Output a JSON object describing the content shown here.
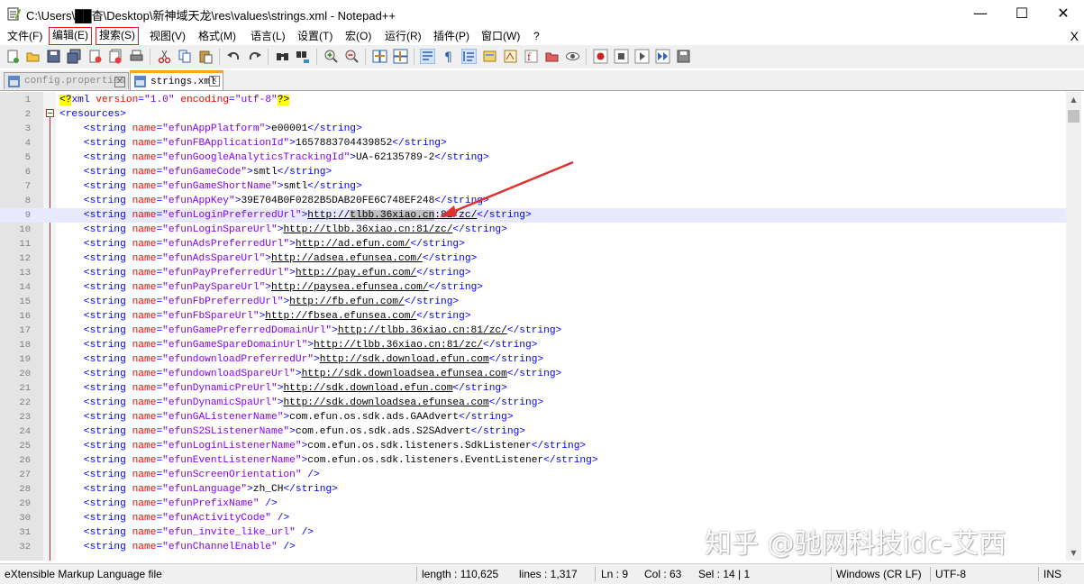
{
  "window": {
    "title": "C:\\Users\\██杳\\Desktop\\新神域天龙\\res\\values\\strings.xml - Notepad++",
    "minimize": "—",
    "maximize": "☐",
    "close": "✕"
  },
  "menu": {
    "items": [
      "文件(F)",
      "编辑(E)",
      "搜索(S)",
      "视图(V)",
      "格式(M)",
      "语言(L)",
      "设置(T)",
      "宏(O)",
      "运行(R)",
      "插件(P)",
      "窗口(W)",
      "?"
    ],
    "highlighted": [
      "编辑(E)",
      "搜索(S)"
    ],
    "close_doc": "X"
  },
  "tabs": [
    {
      "label": "config.properties",
      "active": false,
      "close": "x"
    },
    {
      "label": "strings.xml",
      "active": true,
      "close": "x"
    }
  ],
  "editor": {
    "current_line": 9,
    "lines": [
      {
        "n": "1",
        "p": [
          [
            "decl",
            "<?"
          ],
          [
            "tag",
            "xml "
          ],
          [
            "attr",
            "version"
          ],
          [
            "tag",
            "="
          ],
          [
            "val",
            "\"1.0\""
          ],
          [
            "tag",
            " "
          ],
          [
            "attr",
            "encoding"
          ],
          [
            "tag",
            "="
          ],
          [
            "val",
            "\"utf-8\""
          ],
          [
            "decl",
            "?>"
          ]
        ]
      },
      {
        "n": "2",
        "p": [
          [
            "tag",
            "<resources>"
          ]
        ]
      },
      {
        "n": "3",
        "p": [
          [
            "tag",
            "    <string "
          ],
          [
            "attr",
            "name"
          ],
          [
            "tag",
            "="
          ],
          [
            "val",
            "\"efunAppPlatform\""
          ],
          [
            "tag",
            ">"
          ],
          [
            "text",
            "e00001"
          ],
          [
            "tag",
            "</string>"
          ]
        ]
      },
      {
        "n": "4",
        "p": [
          [
            "tag",
            "    <string "
          ],
          [
            "attr",
            "name"
          ],
          [
            "tag",
            "="
          ],
          [
            "val",
            "\"efunFBApplicationId\""
          ],
          [
            "tag",
            ">"
          ],
          [
            "text",
            "1657883704439852"
          ],
          [
            "tag",
            "</string>"
          ]
        ]
      },
      {
        "n": "5",
        "p": [
          [
            "tag",
            "    <string "
          ],
          [
            "attr",
            "name"
          ],
          [
            "tag",
            "="
          ],
          [
            "val",
            "\"efunGoogleAnalyticsTrackingId\""
          ],
          [
            "tag",
            ">"
          ],
          [
            "text",
            "UA-62135789-2"
          ],
          [
            "tag",
            "</string>"
          ]
        ]
      },
      {
        "n": "6",
        "p": [
          [
            "tag",
            "    <string "
          ],
          [
            "attr",
            "name"
          ],
          [
            "tag",
            "="
          ],
          [
            "val",
            "\"efunGameCode\""
          ],
          [
            "tag",
            ">"
          ],
          [
            "text",
            "smtl"
          ],
          [
            "tag",
            "</string>"
          ]
        ]
      },
      {
        "n": "7",
        "p": [
          [
            "tag",
            "    <string "
          ],
          [
            "attr",
            "name"
          ],
          [
            "tag",
            "="
          ],
          [
            "val",
            "\"efunGameShortName\""
          ],
          [
            "tag",
            ">"
          ],
          [
            "text",
            "smtl"
          ],
          [
            "tag",
            "</string>"
          ]
        ]
      },
      {
        "n": "8",
        "p": [
          [
            "tag",
            "    <string "
          ],
          [
            "attr",
            "name"
          ],
          [
            "tag",
            "="
          ],
          [
            "val",
            "\"efunAppKey\""
          ],
          [
            "tag",
            ">"
          ],
          [
            "text",
            "39E704B0F0282B5DAB20FE6C748EF248"
          ],
          [
            "tag",
            "</string>"
          ]
        ]
      },
      {
        "n": "9",
        "p": [
          [
            "tag",
            "    <string "
          ],
          [
            "attr",
            "name"
          ],
          [
            "tag",
            "="
          ],
          [
            "val",
            "\"efunLoginPreferredUrl\""
          ],
          [
            "tag",
            ">"
          ],
          [
            "url",
            "http://"
          ],
          [
            "sel",
            "tlbb.36xiao.cn"
          ],
          [
            "url",
            ":81/zc/"
          ],
          [
            "tag",
            "</string>"
          ]
        ]
      },
      {
        "n": "10",
        "p": [
          [
            "tag",
            "    <string "
          ],
          [
            "attr",
            "name"
          ],
          [
            "tag",
            "="
          ],
          [
            "val",
            "\"efunLoginSpareUrl\""
          ],
          [
            "tag",
            ">"
          ],
          [
            "url",
            "http://tlbb.36xiao.cn:81/zc/"
          ],
          [
            "tag",
            "</string>"
          ]
        ]
      },
      {
        "n": "11",
        "p": [
          [
            "tag",
            "    <string "
          ],
          [
            "attr",
            "name"
          ],
          [
            "tag",
            "="
          ],
          [
            "val",
            "\"efunAdsPreferredUrl\""
          ],
          [
            "tag",
            ">"
          ],
          [
            "url",
            "http://ad.efun.com/"
          ],
          [
            "tag",
            "</string>"
          ]
        ]
      },
      {
        "n": "12",
        "p": [
          [
            "tag",
            "    <string "
          ],
          [
            "attr",
            "name"
          ],
          [
            "tag",
            "="
          ],
          [
            "val",
            "\"efunAdsSpareUrl\""
          ],
          [
            "tag",
            ">"
          ],
          [
            "url",
            "http://adsea.efunsea.com/"
          ],
          [
            "tag",
            "</string>"
          ]
        ]
      },
      {
        "n": "13",
        "p": [
          [
            "tag",
            "    <string "
          ],
          [
            "attr",
            "name"
          ],
          [
            "tag",
            "="
          ],
          [
            "val",
            "\"efunPayPreferredUrl\""
          ],
          [
            "tag",
            ">"
          ],
          [
            "url",
            "http://pay.efun.com/"
          ],
          [
            "tag",
            "</string>"
          ]
        ]
      },
      {
        "n": "14",
        "p": [
          [
            "tag",
            "    <string "
          ],
          [
            "attr",
            "name"
          ],
          [
            "tag",
            "="
          ],
          [
            "val",
            "\"efunPaySpareUrl\""
          ],
          [
            "tag",
            ">"
          ],
          [
            "url",
            "http://paysea.efunsea.com/"
          ],
          [
            "tag",
            "</string>"
          ]
        ]
      },
      {
        "n": "15",
        "p": [
          [
            "tag",
            "    <string "
          ],
          [
            "attr",
            "name"
          ],
          [
            "tag",
            "="
          ],
          [
            "val",
            "\"efunFbPreferredUrl\""
          ],
          [
            "tag",
            ">"
          ],
          [
            "url",
            "http://fb.efun.com/"
          ],
          [
            "tag",
            "</string>"
          ]
        ]
      },
      {
        "n": "16",
        "p": [
          [
            "tag",
            "    <string "
          ],
          [
            "attr",
            "name"
          ],
          [
            "tag",
            "="
          ],
          [
            "val",
            "\"efunFbSpareUrl\""
          ],
          [
            "tag",
            ">"
          ],
          [
            "url",
            "http://fbsea.efunsea.com/"
          ],
          [
            "tag",
            "</string>"
          ]
        ]
      },
      {
        "n": "17",
        "p": [
          [
            "tag",
            "    <string "
          ],
          [
            "attr",
            "name"
          ],
          [
            "tag",
            "="
          ],
          [
            "val",
            "\"efunGamePreferredDomainUrl\""
          ],
          [
            "tag",
            ">"
          ],
          [
            "url",
            "http://tlbb.36xiao.cn:81/zc/"
          ],
          [
            "tag",
            "</string>"
          ]
        ]
      },
      {
        "n": "18",
        "p": [
          [
            "tag",
            "    <string "
          ],
          [
            "attr",
            "name"
          ],
          [
            "tag",
            "="
          ],
          [
            "val",
            "\"efunGameSpareDomainUrl\""
          ],
          [
            "tag",
            ">"
          ],
          [
            "url",
            "http://tlbb.36xiao.cn:81/zc/"
          ],
          [
            "tag",
            "</string>"
          ]
        ]
      },
      {
        "n": "19",
        "p": [
          [
            "tag",
            "    <string "
          ],
          [
            "attr",
            "name"
          ],
          [
            "tag",
            "="
          ],
          [
            "val",
            "\"efundownloadPreferredUr\""
          ],
          [
            "tag",
            ">"
          ],
          [
            "url",
            "http://sdk.download.efun.com"
          ],
          [
            "tag",
            "</string>"
          ]
        ]
      },
      {
        "n": "20",
        "p": [
          [
            "tag",
            "    <string "
          ],
          [
            "attr",
            "name"
          ],
          [
            "tag",
            "="
          ],
          [
            "val",
            "\"efundownloadSpareUrl\""
          ],
          [
            "tag",
            ">"
          ],
          [
            "url",
            "http://sdk.downloadsea.efunsea.com"
          ],
          [
            "tag",
            "</string>"
          ]
        ]
      },
      {
        "n": "21",
        "p": [
          [
            "tag",
            "    <string "
          ],
          [
            "attr",
            "name"
          ],
          [
            "tag",
            "="
          ],
          [
            "val",
            "\"efunDynamicPreUrl\""
          ],
          [
            "tag",
            ">"
          ],
          [
            "url",
            "http://sdk.download.efun.com"
          ],
          [
            "tag",
            "</string>"
          ]
        ]
      },
      {
        "n": "22",
        "p": [
          [
            "tag",
            "    <string "
          ],
          [
            "attr",
            "name"
          ],
          [
            "tag",
            "="
          ],
          [
            "val",
            "\"efunDynamicSpaUrl\""
          ],
          [
            "tag",
            ">"
          ],
          [
            "url",
            "http://sdk.downloadsea.efunsea.com"
          ],
          [
            "tag",
            "</string>"
          ]
        ]
      },
      {
        "n": "23",
        "p": [
          [
            "tag",
            "    <string "
          ],
          [
            "attr",
            "name"
          ],
          [
            "tag",
            "="
          ],
          [
            "val",
            "\"efunGAListenerName\""
          ],
          [
            "tag",
            ">"
          ],
          [
            "text",
            "com.efun.os.sdk.ads.GAAdvert"
          ],
          [
            "tag",
            "</string>"
          ]
        ]
      },
      {
        "n": "24",
        "p": [
          [
            "tag",
            "    <string "
          ],
          [
            "attr",
            "name"
          ],
          [
            "tag",
            "="
          ],
          [
            "val",
            "\"efunS2SListenerName\""
          ],
          [
            "tag",
            ">"
          ],
          [
            "text",
            "com.efun.os.sdk.ads.S2SAdvert"
          ],
          [
            "tag",
            "</string>"
          ]
        ]
      },
      {
        "n": "25",
        "p": [
          [
            "tag",
            "    <string "
          ],
          [
            "attr",
            "name"
          ],
          [
            "tag",
            "="
          ],
          [
            "val",
            "\"efunLoginListenerName\""
          ],
          [
            "tag",
            ">"
          ],
          [
            "text",
            "com.efun.os.sdk.listeners.SdkListener"
          ],
          [
            "tag",
            "</string>"
          ]
        ]
      },
      {
        "n": "26",
        "p": [
          [
            "tag",
            "    <string "
          ],
          [
            "attr",
            "name"
          ],
          [
            "tag",
            "="
          ],
          [
            "val",
            "\"efunEventListenerName\""
          ],
          [
            "tag",
            ">"
          ],
          [
            "text",
            "com.efun.os.sdk.listeners.EventListener"
          ],
          [
            "tag",
            "</string>"
          ]
        ]
      },
      {
        "n": "27",
        "p": [
          [
            "tag",
            "    <string "
          ],
          [
            "attr",
            "name"
          ],
          [
            "tag",
            "="
          ],
          [
            "val",
            "\"efunScreenOrientation\""
          ],
          [
            "tag",
            " />"
          ]
        ]
      },
      {
        "n": "28",
        "p": [
          [
            "tag",
            "    <string "
          ],
          [
            "attr",
            "name"
          ],
          [
            "tag",
            "="
          ],
          [
            "val",
            "\"efunLanguage\""
          ],
          [
            "tag",
            ">"
          ],
          [
            "text",
            "zh_CH"
          ],
          [
            "tag",
            "</string>"
          ]
        ]
      },
      {
        "n": "29",
        "p": [
          [
            "tag",
            "    <string "
          ],
          [
            "attr",
            "name"
          ],
          [
            "tag",
            "="
          ],
          [
            "val",
            "\"efunPrefixName\""
          ],
          [
            "tag",
            " />"
          ]
        ]
      },
      {
        "n": "30",
        "p": [
          [
            "tag",
            "    <string "
          ],
          [
            "attr",
            "name"
          ],
          [
            "tag",
            "="
          ],
          [
            "val",
            "\"efunActivityCode\""
          ],
          [
            "tag",
            " />"
          ]
        ]
      },
      {
        "n": "31",
        "p": [
          [
            "tag",
            "    <string "
          ],
          [
            "attr",
            "name"
          ],
          [
            "tag",
            "="
          ],
          [
            "val",
            "\"efun_invite_like_url\""
          ],
          [
            "tag",
            " />"
          ]
        ]
      },
      {
        "n": "32",
        "p": [
          [
            "tag",
            "    <string "
          ],
          [
            "attr",
            "name"
          ],
          [
            "tag",
            "="
          ],
          [
            "val",
            "\"efunChannelEnable\""
          ],
          [
            "tag",
            " />"
          ]
        ]
      }
    ]
  },
  "status": {
    "file_type": "eXtensible Markup Language file",
    "length": "length : 110,625",
    "lines": "lines : 1,317",
    "ln": "Ln : 9",
    "col": "Col : 63",
    "sel": "Sel : 14 | 1",
    "eol": "Windows (CR LF)",
    "encoding": "UTF-8",
    "mode": "INS"
  },
  "watermark": "知乎 @驰网科技idc-艾西",
  "colors": {
    "tag": "#0000ff",
    "attr": "#ff0000",
    "value": "#8000ff",
    "highlight_box": "#e02020",
    "annotation_arrow": "#e03030"
  }
}
